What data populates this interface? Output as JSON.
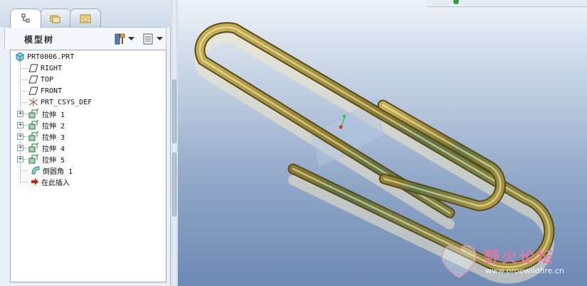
{
  "panel": {
    "title": "模型树",
    "tabs": [
      {
        "name": "model-tree-tab",
        "icon": "model-tree-icon",
        "active": true
      },
      {
        "name": "folder-browser-tab",
        "icon": "folder-browser-icon",
        "active": false
      },
      {
        "name": "favorites-tab",
        "icon": "favorites-icon",
        "active": false
      }
    ],
    "tools": [
      {
        "icon": "tree-settings-icon"
      },
      {
        "icon": "tree-columns-icon"
      }
    ]
  },
  "tree": {
    "items": [
      {
        "label": "PRT0006.PRT",
        "icon": "part-icon"
      },
      {
        "label": "RIGHT",
        "icon": "datum-plane-icon"
      },
      {
        "label": "TOP",
        "icon": "datum-plane-icon"
      },
      {
        "label": "FRONT",
        "icon": "datum-plane-icon"
      },
      {
        "label": "PRT_CSYS_DEF",
        "icon": "csys-icon"
      },
      {
        "label": "拉伸 1",
        "icon": "extrude-icon"
      },
      {
        "label": "拉伸 2",
        "icon": "extrude-icon"
      },
      {
        "label": "拉伸 3",
        "icon": "extrude-icon"
      },
      {
        "label": "拉伸 4",
        "icon": "extrude-icon"
      },
      {
        "label": "拉伸 5",
        "icon": "extrude-icon"
      },
      {
        "label": "倒圆角 1",
        "icon": "round-icon"
      },
      {
        "label": "在此插入",
        "icon": "insert-here-arrow-icon"
      }
    ]
  },
  "watermark": {
    "text": "野火论坛",
    "url": "www.proewildfire.cn"
  },
  "colors": {
    "viewport_top": "#edf2f8",
    "viewport_bottom": "#6d89b4",
    "clip_gold": "#9a8a3a",
    "clip_green": "#5b7448",
    "insert_arrow": "#cc2200"
  }
}
